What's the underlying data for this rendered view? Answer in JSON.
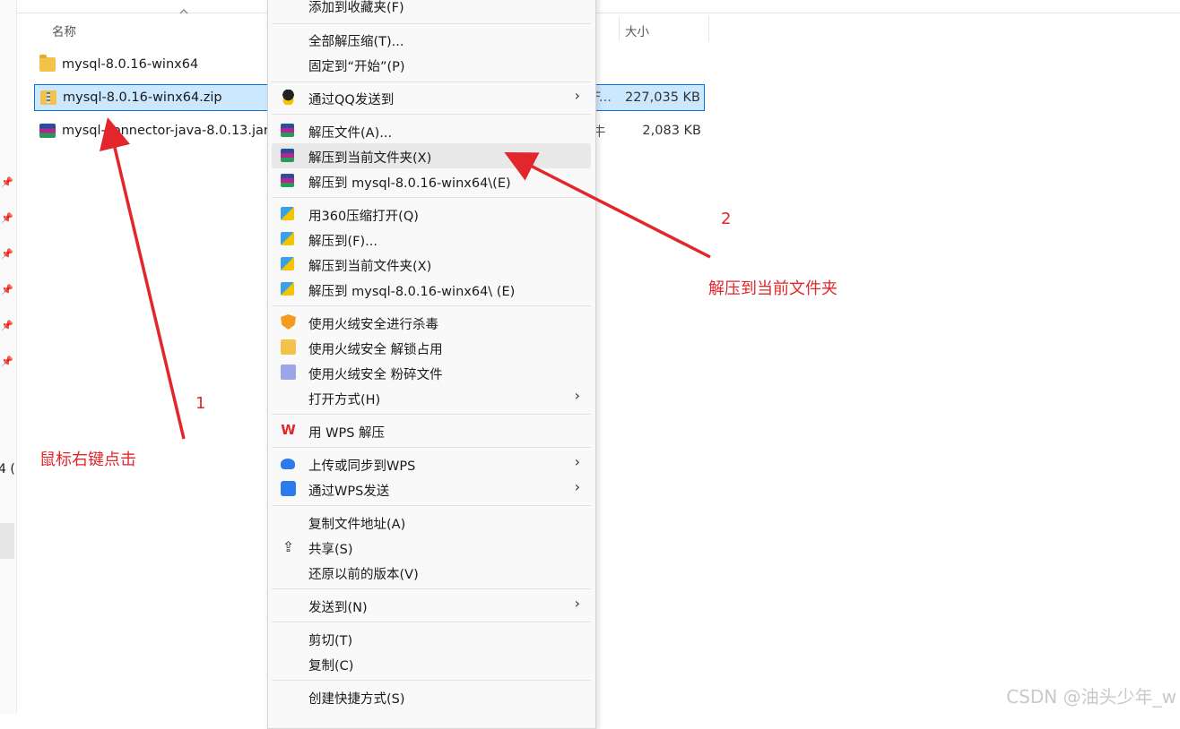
{
  "columns": {
    "name": "名称",
    "size": "大小"
  },
  "files": [
    {
      "name": "mysql-8.0.16-winx64",
      "type": "folder",
      "size": "",
      "selected": false
    },
    {
      "name": "mysql-8.0.16-winx64.zip",
      "type": "zip",
      "size": "227,035 KB",
      "selected": true,
      "type_fragment": "F..."
    },
    {
      "name": "mysql-connector-java-8.0.13.jar",
      "type": "rar",
      "size": "2,083 KB",
      "selected": false,
      "type_fragment": "牛"
    }
  ],
  "sidebar": {
    "drive_fragment": "4 ("
  },
  "context_menu": {
    "items": [
      {
        "label": "添加到收藏夹(F)",
        "icon": ""
      },
      {
        "label": "全部解压缩(T)...",
        "icon": ""
      },
      {
        "label": "固定到“开始”(P)",
        "icon": ""
      },
      {
        "label": "通过QQ发送到",
        "icon": "qq-icon",
        "submenu": true
      },
      {
        "label": "解压文件(A)...",
        "icon": "winrar-icon"
      },
      {
        "label": "解压到当前文件夹(X)",
        "icon": "winrar-icon",
        "highlighted": true
      },
      {
        "label": "解压到 mysql-8.0.16-winx64\\(E)",
        "icon": "winrar-icon"
      },
      {
        "label": "用360压缩打开(Q)",
        "icon": "360zip-icon"
      },
      {
        "label": "解压到(F)...",
        "icon": "360zip-icon"
      },
      {
        "label": "解压到当前文件夹(X)",
        "icon": "360zip-icon"
      },
      {
        "label": "解压到 mysql-8.0.16-winx64\\ (E)",
        "icon": "360zip-icon"
      },
      {
        "label": "使用火绒安全进行杀毒",
        "icon": "huorong-shield-icon"
      },
      {
        "label": "使用火绒安全 解锁占用",
        "icon": "folder-unlock-icon"
      },
      {
        "label": "使用火绒安全 粉碎文件",
        "icon": "shredder-icon"
      },
      {
        "label": "打开方式(H)",
        "icon": "",
        "submenu": true
      },
      {
        "label": "用 WPS 解压",
        "icon": "wps-icon"
      },
      {
        "label": "上传或同步到WPS",
        "icon": "cloud-upload-icon",
        "submenu": true
      },
      {
        "label": "通过WPS发送",
        "icon": "send-icon",
        "submenu": true
      },
      {
        "label": "复制文件地址(A)",
        "icon": ""
      },
      {
        "label": "共享(S)",
        "icon": "share-icon"
      },
      {
        "label": "还原以前的版本(V)",
        "icon": ""
      },
      {
        "label": "发送到(N)",
        "icon": "",
        "submenu": true
      },
      {
        "label": "剪切(T)",
        "icon": ""
      },
      {
        "label": "复制(C)",
        "icon": ""
      },
      {
        "label": "创建快捷方式(S)",
        "icon": ""
      }
    ],
    "submenu_glyph": "›"
  },
  "annotations": {
    "step1_number": "1",
    "step1_text": "鼠标右键点击",
    "step2_number": "2",
    "step2_text": "解压到当前文件夹",
    "color": "#e2262b"
  },
  "watermark": "CSDN @油头少年_w"
}
